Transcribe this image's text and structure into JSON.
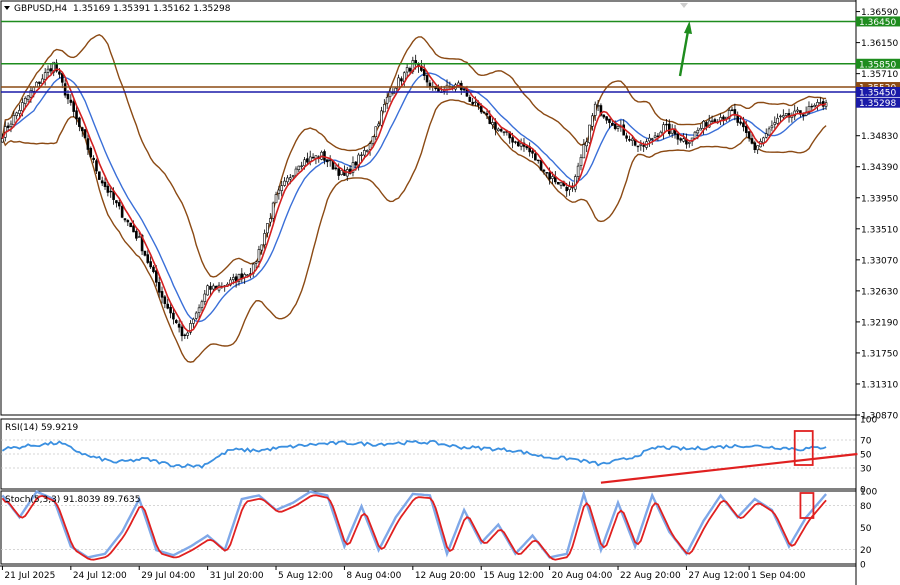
{
  "header": {
    "symbol_text": "GBPUSD,H4",
    "ohlc_text": "1.35169 1.35391 1.35162 1.35298"
  },
  "colors": {
    "background": "#ffffff",
    "grid_border": "#000000",
    "candle": "#000000",
    "bollinger": "#8b4a14",
    "ma_fast": "#d32020",
    "ma_slow": "#3a6fd8",
    "level_green": "#1e8c1e",
    "level_brown": "#8b4a14",
    "level_blue": "#1a1aa8",
    "price_tag": "#1a1aa8",
    "rsi_line": "#3a8fe0",
    "trendline": "#e02020",
    "stoch_main": "#e02020",
    "stoch_signal": "#7fa8e8",
    "highlight_box": "#e02020",
    "arrow": "#1e8c1e"
  },
  "chart_data": [
    {
      "type": "candlestick",
      "title": "GBPUSD,H4",
      "y_ticks": [
        "1.36590",
        "1.36150",
        "1.35710",
        "1.34830",
        "1.34390",
        "1.33950",
        "1.33510",
        "1.33070",
        "1.32630",
        "1.32190",
        "1.31750",
        "1.31310",
        "1.30870"
      ],
      "ylim": [
        1.3087,
        1.3674
      ],
      "x_ticks": [
        "21 Jul 2025",
        "24 Jul 12:00",
        "29 Jul 04:00",
        "31 Jul 20:00",
        "5 Aug 12:00",
        "8 Aug 04:00",
        "12 Aug 20:00",
        "15 Aug 12:00",
        "20 Aug 04:00",
        "22 Aug 20:00",
        "27 Aug 12:00",
        "1 Sep 04:00"
      ],
      "close_anchor_bars": [
        0,
        10,
        18,
        26,
        34,
        40,
        48,
        56,
        64,
        72,
        80,
        88,
        96,
        104,
        112,
        120,
        128,
        136,
        144,
        152,
        160,
        168,
        176,
        184,
        192,
        200,
        208,
        216,
        224,
        232,
        240,
        248,
        256,
        264,
        272,
        280,
        289
      ],
      "close_anchor_values": [
        1.3485,
        1.3545,
        1.3585,
        1.3505,
        1.3425,
        1.3385,
        1.3335,
        1.3255,
        1.3195,
        1.3265,
        1.3275,
        1.3295,
        1.3395,
        1.3445,
        1.3455,
        1.3425,
        1.3465,
        1.3545,
        1.3585,
        1.3545,
        1.3555,
        1.3515,
        1.3485,
        1.3465,
        1.3425,
        1.3405,
        1.3525,
        1.3495,
        1.3465,
        1.3495,
        1.3475,
        1.3505,
        1.3515,
        1.3465,
        1.3505,
        1.3515,
        1.35298
      ],
      "levels": [
        {
          "price": 1.3645,
          "label": "1.36450",
          "color": "green"
        },
        {
          "price": 1.3585,
          "label": "1.35850",
          "color": "green"
        },
        {
          "price": 1.3552,
          "label": "1.35520",
          "color": "brown"
        },
        {
          "price": 1.3545,
          "label": "1.35450",
          "color": "blue"
        }
      ],
      "last_price_label": "1.35298",
      "last_price": 1.35298,
      "indicators": [
        "Bollinger Bands",
        "Moving Average (fast)",
        "Moving Average (slow)"
      ]
    },
    {
      "type": "line",
      "title": "RSI(14) 59.9219",
      "ylim": [
        0,
        100
      ],
      "y_ticks": [
        "100",
        "70",
        "50",
        "30",
        "0"
      ],
      "anchor_bars": [
        0,
        10,
        20,
        30,
        40,
        50,
        60,
        70,
        80,
        90,
        100,
        110,
        120,
        130,
        140,
        150,
        160,
        170,
        180,
        190,
        200,
        210,
        220,
        230,
        240,
        250,
        260,
        270,
        280,
        289
      ],
      "anchor_values": [
        57,
        62,
        66,
        47,
        38,
        43,
        34,
        33,
        56,
        55,
        60,
        64,
        66,
        64,
        66,
        67,
        60,
        58,
        55,
        46,
        43,
        35,
        44,
        60,
        57,
        60,
        62,
        60,
        57,
        59.92
      ],
      "trendline": {
        "x_start_bar": 210,
        "y_start": 9,
        "x_end_bar": 300,
        "y_end": 50
      }
    },
    {
      "type": "line",
      "title": "Stoch(5,3,3) 91.8039 89.7635",
      "ylim": [
        0,
        100
      ],
      "y_ticks": [
        "100",
        "80",
        "50",
        "20",
        "0"
      ],
      "anchor_bars": [
        0,
        6,
        12,
        18,
        24,
        30,
        36,
        42,
        48,
        54,
        60,
        66,
        72,
        78,
        84,
        90,
        96,
        102,
        108,
        114,
        120,
        126,
        132,
        138,
        144,
        150,
        156,
        162,
        168,
        174,
        180,
        186,
        192,
        198,
        204,
        210,
        216,
        222,
        228,
        234,
        240,
        246,
        252,
        258,
        264,
        270,
        276,
        282,
        289
      ],
      "anchor_values": [
        90,
        60,
        95,
        85,
        20,
        5,
        10,
        40,
        85,
        15,
        8,
        20,
        35,
        15,
        85,
        90,
        70,
        80,
        95,
        90,
        20,
        75,
        15,
        60,
        92,
        90,
        10,
        70,
        25,
        50,
        10,
        35,
        5,
        10,
        92,
        15,
        80,
        20,
        90,
        40,
        10,
        55,
        90,
        60,
        85,
        70,
        20,
        60,
        91.8
      ],
      "signal_last": 89.76
    }
  ]
}
